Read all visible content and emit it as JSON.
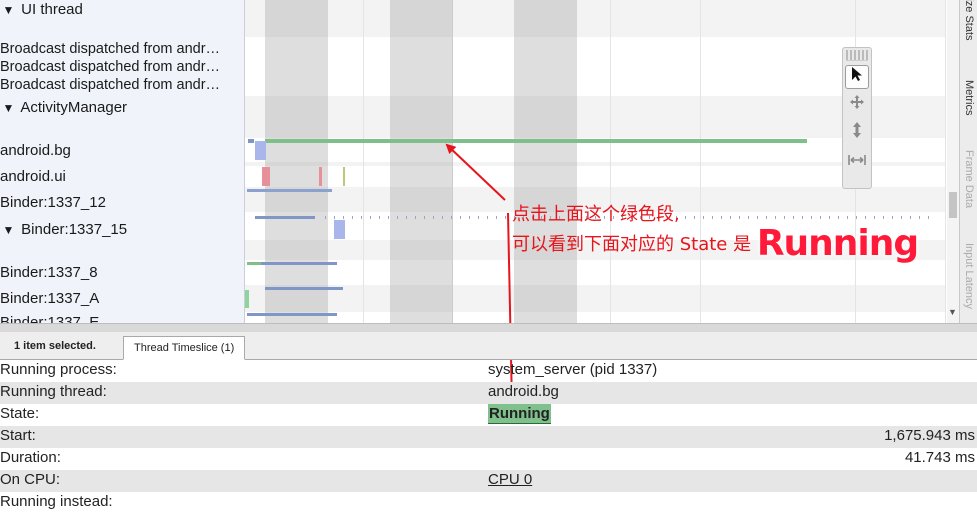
{
  "track_labels": {
    "ui_thread": "UI thread",
    "broadcast_1": "Broadcast dispatched from andr…",
    "broadcast_2": "Broadcast dispatched from andr…",
    "broadcast_3": "Broadcast dispatched from andr…",
    "activity_manager": "ActivityManager",
    "android_bg": "android.bg",
    "android_ui": "android.ui",
    "binder_12": "Binder:1337_12",
    "binder_15": "Binder:1337_15",
    "binder_8": "Binder:1337_8",
    "binder_a": "Binder:1337_A",
    "binder_e": "Binder:1337_E"
  },
  "side_tabs": {
    "size_stats": "Size Stats",
    "metrics": "Metrics",
    "frame_data": "Frame Data",
    "input_latency": "Input Latency"
  },
  "toolbar_icons": [
    "selection-tool-icon",
    "pan-tool-icon",
    "zoom-tool-icon",
    "timing-tool-icon"
  ],
  "annotation": {
    "line1": "点击上面这个绿色段,",
    "line2_prefix": "可以看到下面对应的 State 是",
    "highlight": "Running"
  },
  "selection_tabs": {
    "count": "1 item selected.",
    "tab": "Thread Timeslice (1)"
  },
  "details": [
    {
      "key": "Running process:",
      "value": "system_server (pid 1337)"
    },
    {
      "key": "Running thread:",
      "value": "android.bg"
    },
    {
      "key": "State:",
      "value": "Running"
    },
    {
      "key": "Start:",
      "value": "1,675.943 ms"
    },
    {
      "key": "Duration:",
      "value": "41.743 ms"
    },
    {
      "key": "On CPU:",
      "value": "CPU 0"
    },
    {
      "key": "Running instead:",
      "value": ""
    }
  ],
  "colors": {
    "annotation_red": "#e8141b",
    "running_green": "#7fc08c",
    "slice_blue": "#7f96c6",
    "slice_pink": "#e6909a"
  }
}
